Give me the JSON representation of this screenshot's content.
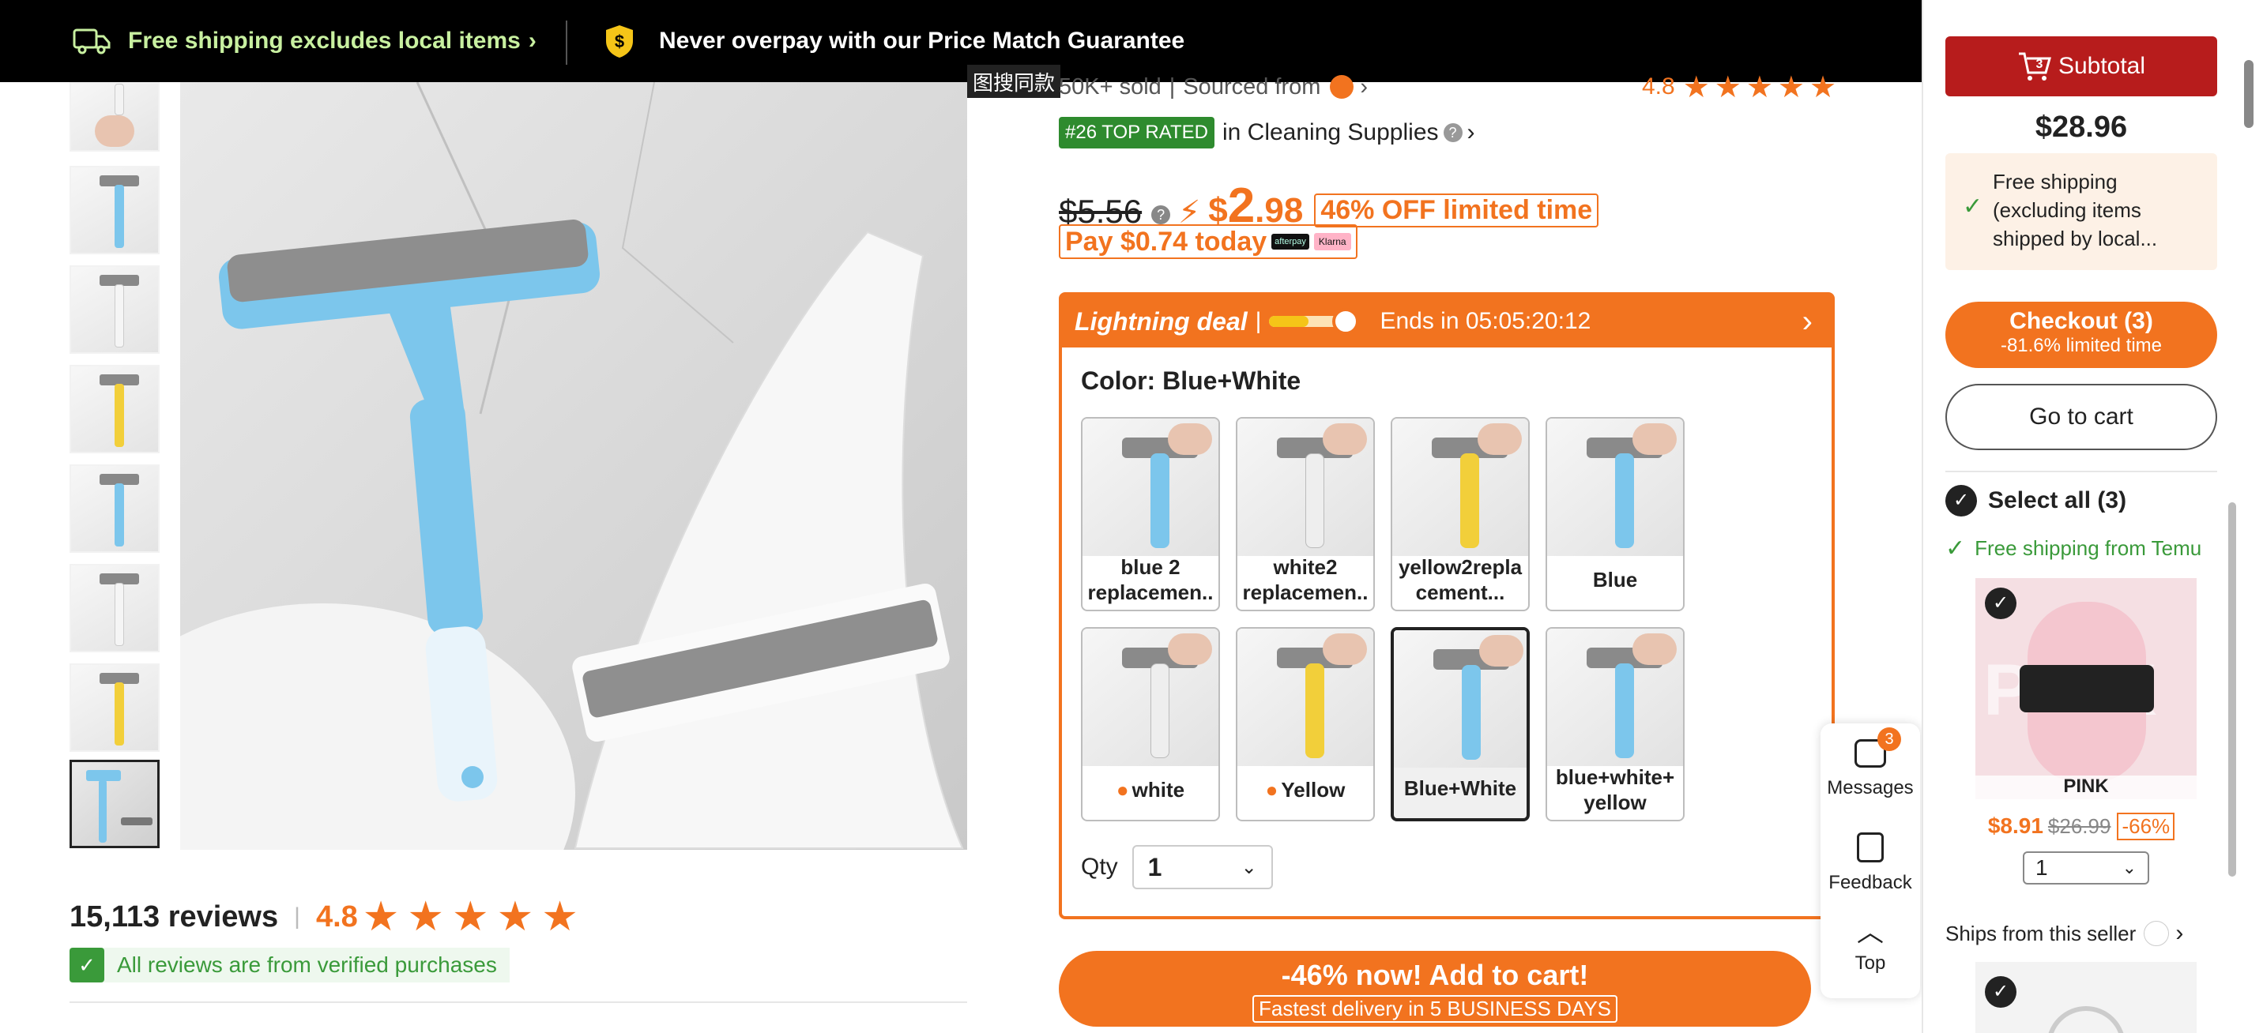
{
  "top_banner": {
    "shipping_text": "Free shipping excludes local items",
    "price_match_text": "Never overpay with our Price Match Guarantee"
  },
  "image_search_tooltip": "图搜同款",
  "product": {
    "sold_text": "50K+ sold",
    "sourced_from": "Sourced from",
    "rating": "4.8",
    "rank_badge": "#26 TOP RATED",
    "rank_category": "in Cleaning Supplies",
    "original_price": "$5.56",
    "price_symbol": "$",
    "price_whole": "2",
    "price_cents": ".98",
    "discount": "46% OFF limited time",
    "pay_today": "Pay $0.74 today",
    "afterpay": "afterpay",
    "klarna": "Klarna"
  },
  "deal": {
    "title": "Lightning deal",
    "ends": "Ends in 05:05:20:12",
    "progress": 0.45
  },
  "color": {
    "label": "Color:",
    "selected": "Blue+White",
    "options": [
      {
        "label": "blue 2 replacemen..",
        "swatch": "#7cc6ec"
      },
      {
        "label": "white2 replacemen..",
        "swatch": "#eeeeee"
      },
      {
        "label": "yellow2repla cement...",
        "swatch": "#f2cf3a"
      },
      {
        "label": "Blue",
        "swatch": "#7cc6ec"
      },
      {
        "label": "white",
        "swatch": "#eeeeee"
      },
      {
        "label": "Yellow",
        "swatch": "#f2cf3a"
      },
      {
        "label": "Blue+White",
        "swatch": "#7cc6ec"
      },
      {
        "label": "blue+white+ yellow",
        "swatch": "#7cc6ec"
      }
    ]
  },
  "qty": {
    "label": "Qty",
    "value": "1"
  },
  "add_to_cart": {
    "main": "-46% now! Add to cart!",
    "sub": "Fastest delivery in 5 BUSINESS DAYS"
  },
  "reviews": {
    "count": "15,113 reviews",
    "rating": "4.8",
    "verified": "All reviews are from verified purchases"
  },
  "floating": {
    "messages_label": "Messages",
    "messages_count": "3",
    "feedback_label": "Feedback",
    "top_label": "Top"
  },
  "cart": {
    "subtotal_label": "Subtotal",
    "subtotal_count": "3",
    "total": "$28.96",
    "free_shipping": "Free shipping (excluding items shipped by local...",
    "checkout": "Checkout (3)",
    "checkout_sub": "-81.6% limited time",
    "go_to_cart": "Go to cart",
    "select_all": "Select all (3)",
    "free_from": "Free shipping from Temu",
    "item": {
      "label": "PINK",
      "price": "$8.91",
      "old_price": "$26.99",
      "discount": "-66%",
      "qty": "1"
    },
    "ships_from": "Ships from this seller"
  },
  "colors": {
    "accent": "#f2731f",
    "green": "#3a9a3a",
    "subtotal_red": "#b71c1c",
    "blue_product": "#7cc6ec"
  }
}
